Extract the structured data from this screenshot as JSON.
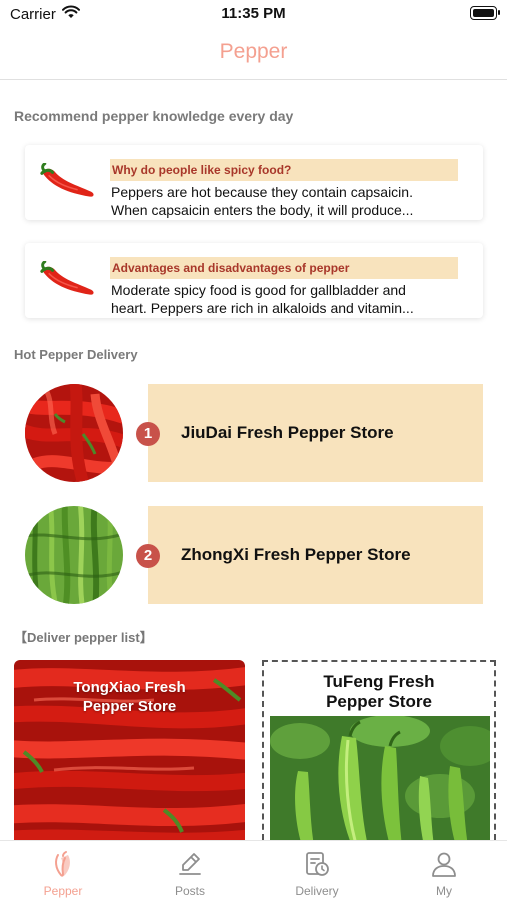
{
  "status_bar": {
    "carrier": "Carrier",
    "time": "11:35 PM"
  },
  "nav": {
    "title": "Pepper"
  },
  "knowledge": {
    "section_title": "Recommend pepper knowledge every day",
    "items": [
      {
        "title": "Why do people like spicy food?",
        "desc_line1": "Peppers are hot because they contain capsaicin.",
        "desc_line2": "When capsaicin enters the body, it will produce..."
      },
      {
        "title": "Advantages and disadvantages of pepper",
        "desc_line1": "Moderate spicy food is good for gallbladder and",
        "desc_line2": "heart. Peppers are rich in alkaloids and vitamin..."
      }
    ]
  },
  "hot_delivery": {
    "section_title": "Hot Pepper Delivery",
    "stores": [
      {
        "rank": "1",
        "name": "JiuDai Fresh Pepper Store"
      },
      {
        "rank": "2",
        "name": "ZhongXi Fresh Pepper Store"
      }
    ]
  },
  "deliver_list": {
    "section_title": "【Deliver pepper list】",
    "tiles": [
      {
        "line1": "TongXiao Fresh",
        "line2": "Pepper Store"
      },
      {
        "line1": "TuFeng Fresh",
        "line2": "Pepper Store"
      }
    ]
  },
  "tabs": [
    {
      "label": "Pepper",
      "icon": "pepper-icon",
      "active": true
    },
    {
      "label": "Posts",
      "icon": "edit-icon",
      "active": false
    },
    {
      "label": "Delivery",
      "icon": "delivery-clock-icon",
      "active": false
    },
    {
      "label": "My",
      "icon": "person-icon",
      "active": false
    }
  ],
  "colors": {
    "accent": "#f4a090",
    "panel": "#f8e3bd",
    "rank_badge": "#c8524a",
    "knowledge_title": "#a8372a"
  }
}
